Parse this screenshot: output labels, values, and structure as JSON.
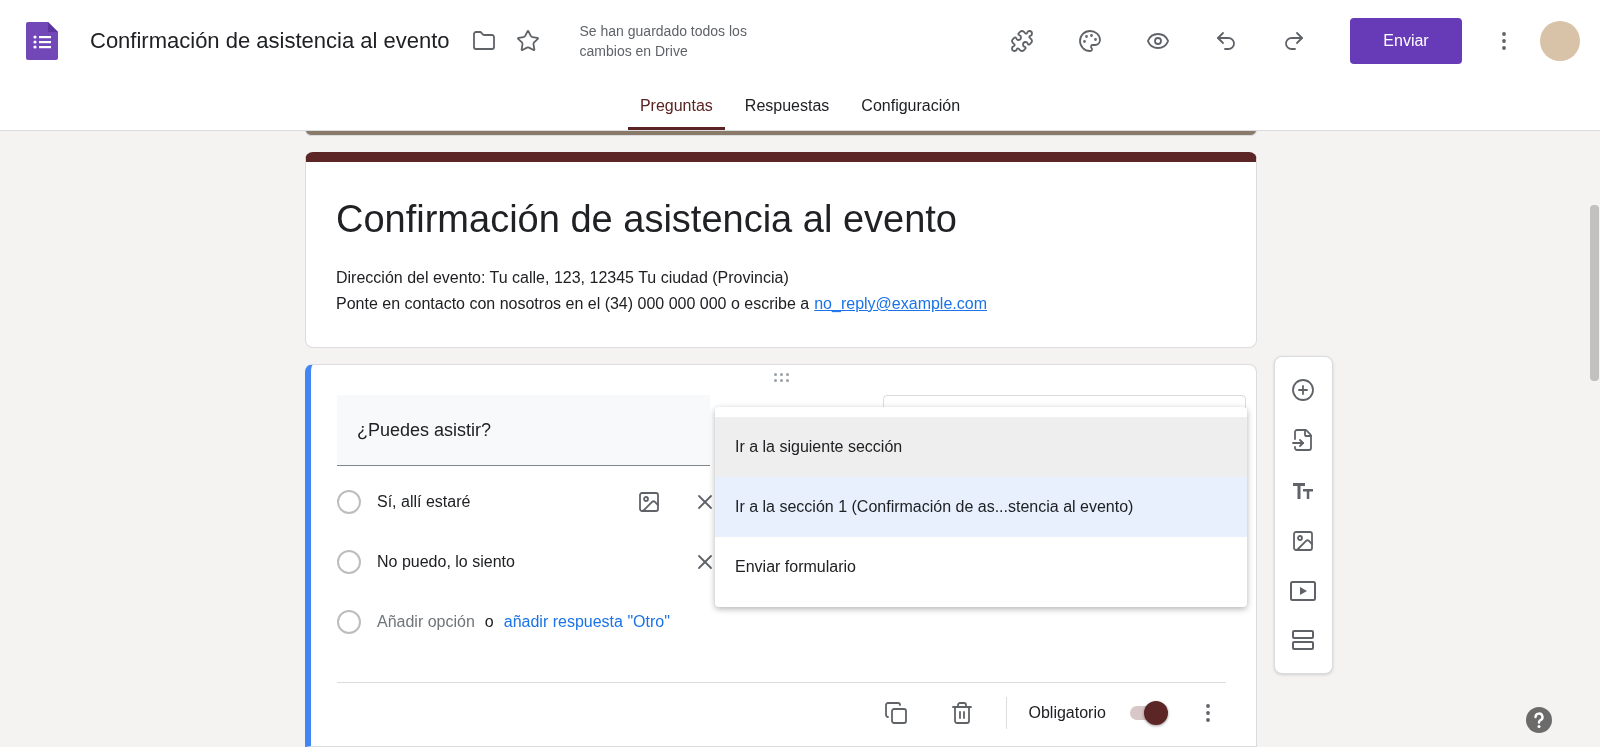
{
  "header": {
    "doc_title": "Confirmación de asistencia al evento",
    "save_status": "Se han guardado todos los cambios en Drive",
    "send_button": "Enviar"
  },
  "tabs": [
    {
      "label": "Preguntas",
      "selected": true
    },
    {
      "label": "Respuestas",
      "selected": false
    },
    {
      "label": "Configuración",
      "selected": false
    }
  ],
  "form_header": {
    "title": "Confirmación de asistencia al evento",
    "address": "Dirección del evento: Tu calle, 123, 12345 Tu ciudad (Provincia)",
    "contact_text": "Ponte en contacto con nosotros en el (34) 000 000 000 o escribe a",
    "contact_link": "no_reply@example.com"
  },
  "question": {
    "title": "¿Puedes asistir?",
    "options": [
      {
        "label": "Sí, allí estaré",
        "image_button": true,
        "selected": false
      },
      {
        "label": "No puedo, lo siento",
        "image_button": false,
        "selected": false
      }
    ],
    "add_option": "Añadir opción",
    "add_separator": "o",
    "add_other": "añadir respuesta \"Otro\"",
    "required_label": "Obligatorio",
    "required": true
  },
  "section_menu": {
    "items": [
      {
        "label": "Ir a la siguiente sección",
        "selected": false,
        "hovered": true
      },
      {
        "label": "Ir a la sección 1 (Confirmación de as...stencia al evento)",
        "selected": true,
        "hovered": false
      },
      {
        "label": "Enviar formulario",
        "selected": false,
        "hovered": false
      }
    ]
  }
}
